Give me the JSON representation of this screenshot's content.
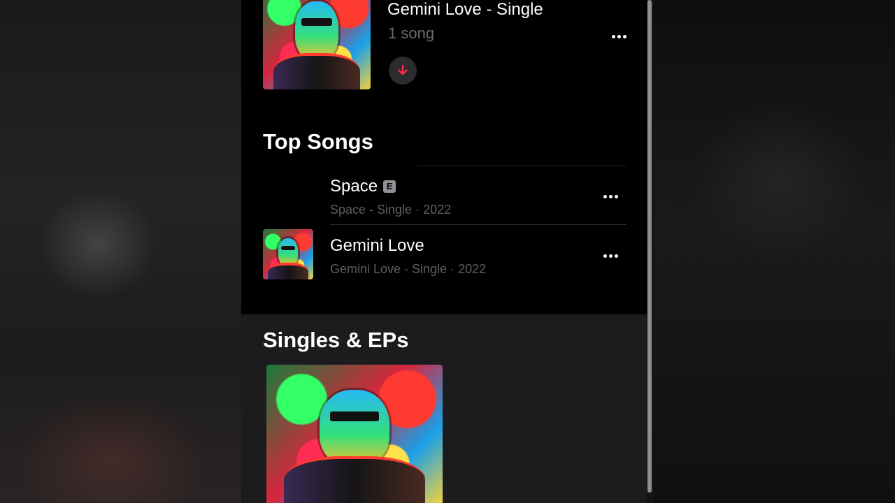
{
  "album": {
    "title": "Gemini Love - Single",
    "subtitle": "1 song"
  },
  "top_songs": {
    "heading": "Top Songs",
    "items": [
      {
        "title": "Space",
        "badge": "E",
        "subtitle": "Space - Single · 2022"
      },
      {
        "title": "Gemini Love",
        "subtitle": "Gemini Love - Single · 2022"
      }
    ]
  },
  "singles": {
    "heading": "Singles & EPs"
  },
  "icons": {
    "more": "ellipsis-icon",
    "download": "download-arrow-icon"
  },
  "colors": {
    "accent": "#fa2d48",
    "background": "#000000",
    "section_background": "#1c1c1e"
  }
}
